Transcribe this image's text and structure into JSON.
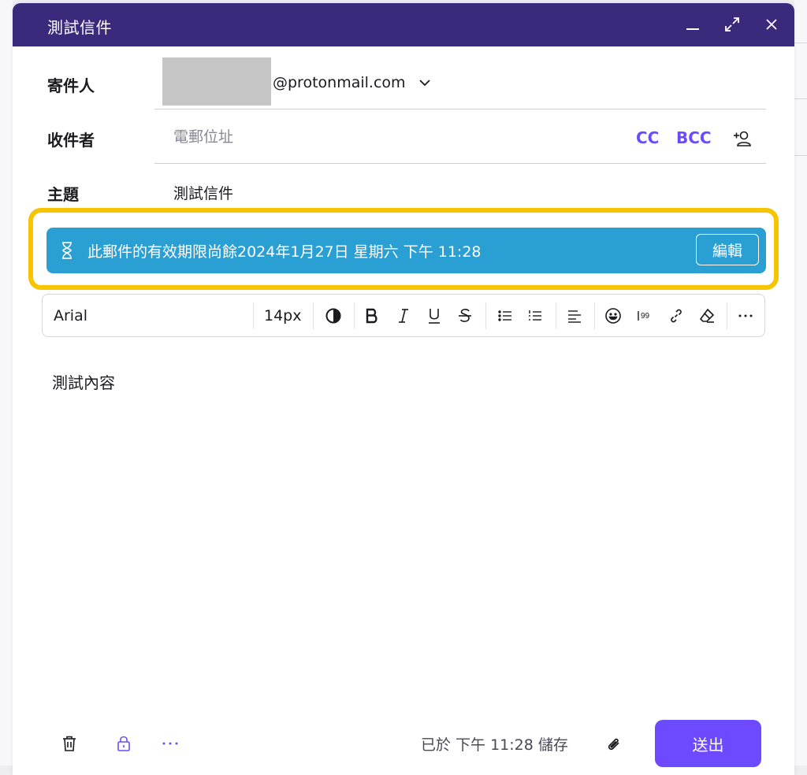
{
  "window": {
    "title": "測試信件",
    "minimize_icon": "minimize-icon",
    "maximize_icon": "maximize-icon",
    "close_icon": "close-icon",
    "header_color": "#3b2a7c"
  },
  "from": {
    "label": "寄件人",
    "address": "@protonmail.com",
    "dropdown_icon": "chevron-down-icon"
  },
  "to": {
    "label": "收件者",
    "value": "",
    "placeholder": "電郵位址",
    "cc_label": "CC",
    "bcc_label": "BCC",
    "add_contact_icon": "add-contact-icon"
  },
  "subject": {
    "label": "主題",
    "value": "測試信件"
  },
  "expiration_banner": {
    "icon": "hourglass-icon",
    "text": "此郵件的有效期限尚餘2024年1月27日 星期六 下午 11:28",
    "edit_label": "編輯",
    "color": "#2a9fd4",
    "highlight_color": "#f7c400"
  },
  "toolbar": {
    "font_family": "Arial",
    "font_size": "14px",
    "icons": [
      "contrast-icon",
      "bold-icon",
      "italic-icon",
      "underline-icon",
      "strikethrough-icon",
      "bullet-list-icon",
      "numbered-list-icon",
      "align-left-icon",
      "emoji-icon",
      "quote-icon",
      "link-icon",
      "clear-format-icon",
      "more-icon"
    ]
  },
  "body": {
    "text": "測試內容"
  },
  "footer": {
    "delete_icon": "trash-icon",
    "encryption_icon": "lock-icon",
    "more_icon": "more-options-icon",
    "saved_text": "已於 下午 11:28 儲存",
    "attach_icon": "paperclip-icon",
    "send_label": "送出",
    "accent_color": "#6d4aff"
  }
}
